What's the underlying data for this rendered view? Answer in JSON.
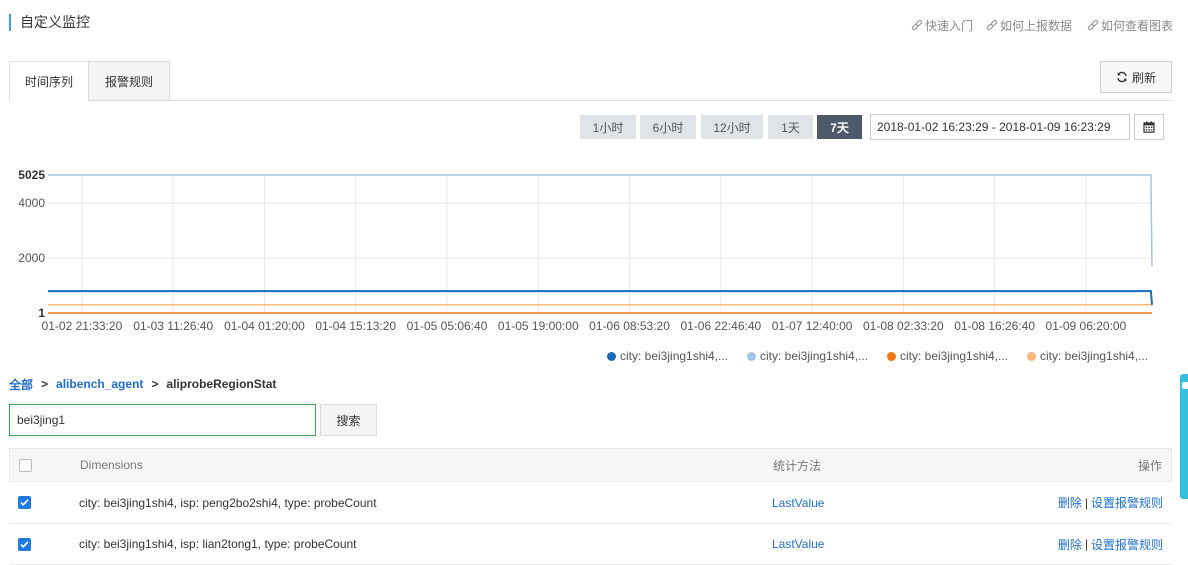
{
  "page": {
    "title": "自定义监控"
  },
  "help_links": [
    {
      "icon": "link-icon",
      "label": "快速入门"
    },
    {
      "icon": "link-icon",
      "label": "如何上报数据"
    },
    {
      "icon": "link-icon",
      "label": "如何查看图表"
    }
  ],
  "tabs": [
    {
      "label": "时间序列",
      "active": true
    },
    {
      "label": "报警规则",
      "active": false
    }
  ],
  "refresh": {
    "icon": "refresh-icon",
    "label": "刷新"
  },
  "time_range": {
    "options": [
      {
        "label": "1小时",
        "active": false
      },
      {
        "label": "6小时",
        "active": false
      },
      {
        "label": "12小时",
        "active": false
      },
      {
        "label": "1天",
        "active": false
      },
      {
        "label": "7天",
        "active": true
      }
    ],
    "value": "2018-01-02 16:23:29 - 2018-01-09 16:23:29",
    "calendar_icon": "calendar-icon"
  },
  "chart_data": {
    "type": "line",
    "title": "",
    "xlabel": "",
    "ylabel": "",
    "xlim": [
      "2018-01-02 16:23:29",
      "2018-01-09 16:23:29"
    ],
    "ylim": [
      1,
      5025
    ],
    "yticks": [
      5025,
      4000,
      2000,
      1
    ],
    "xticks": [
      "01-02 21:33:20",
      "01-03 11:26:40",
      "01-04 01:20:00",
      "01-04 15:13:20",
      "01-05 05:06:40",
      "01-05 19:00:00",
      "01-06 08:53:20",
      "01-06 22:46:40",
      "01-07 12:40:00",
      "01-08 02:33:20",
      "01-08 16:26:40",
      "01-09 06:20:00"
    ],
    "grid": true,
    "legend": "bottom-right",
    "series": [
      {
        "name": "city: bei3jing1shi4,...",
        "color": "#1a6cb8",
        "points": [
          [
            "2018-01-02 16:23:29",
            800
          ],
          [
            "2018-01-09 16:13:29",
            800
          ],
          [
            "2018-01-09 16:23:29",
            300
          ]
        ]
      },
      {
        "name": "city: bei3jing1shi4,...",
        "color": "#a3c5e6",
        "points": [
          [
            "2018-01-02 16:23:29",
            5025
          ],
          [
            "2018-01-09 16:13:29",
            5025
          ],
          [
            "2018-01-09 16:23:29",
            1700
          ]
        ]
      },
      {
        "name": "city: bei3jing1shi4,...",
        "color": "#f07810",
        "points": [
          [
            "2018-01-02 16:23:29",
            1
          ],
          [
            "2018-01-09 16:23:29",
            1
          ]
        ]
      },
      {
        "name": "city: bei3jing1shi4,...",
        "color": "#f6b97a",
        "points": [
          [
            "2018-01-02 16:23:29",
            300
          ],
          [
            "2018-01-09 16:23:29",
            300
          ]
        ]
      }
    ]
  },
  "breadcrumb": {
    "items": [
      {
        "label": "全部",
        "link": true
      },
      {
        "label": "alibench_agent",
        "link": true
      },
      {
        "label": "aliprobeRegionStat",
        "link": false
      }
    ],
    "separator": ">"
  },
  "search": {
    "value": "bei3jing1",
    "button_label": "搜索"
  },
  "table": {
    "header_checked": false,
    "columns": {
      "dimensions": "Dimensions",
      "method": "统计方法",
      "actions": "操作"
    },
    "rows": [
      {
        "checked": true,
        "dimensions": "city: bei3jing1shi4, isp: peng2bo2shi4, type: probeCount",
        "method": "LastValue",
        "delete_label": "删除",
        "alarm_label": "设置报警规则"
      },
      {
        "checked": true,
        "dimensions": "city: bei3jing1shi4, isp: lian2tong1, type: probeCount",
        "method": "LastValue",
        "delete_label": "删除",
        "alarm_label": "设置报警规则"
      }
    ],
    "action_separator": "|"
  },
  "colors": {
    "accent": "#1e6fce",
    "title_bar": "#3aa0d8",
    "active_range": "#4d5a69",
    "search_border": "#3fa34d",
    "float_tab": "#35bfdc"
  }
}
